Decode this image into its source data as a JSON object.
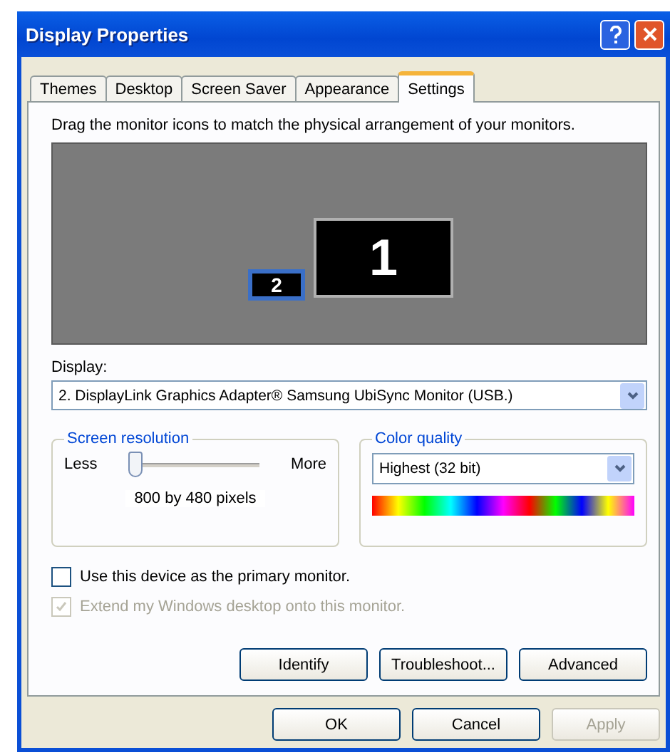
{
  "window": {
    "title": "Display Properties"
  },
  "tabs": [
    {
      "label": "Themes",
      "selected": false
    },
    {
      "label": "Desktop",
      "selected": false
    },
    {
      "label": "Screen Saver",
      "selected": false
    },
    {
      "label": "Appearance",
      "selected": false
    },
    {
      "label": "Settings",
      "selected": true
    }
  ],
  "description": "Drag the monitor icons to match the physical arrangement of your monitors.",
  "monitors": [
    {
      "label": "2",
      "selected": true
    },
    {
      "label": "1",
      "selected": false
    }
  ],
  "display": {
    "label": "Display:",
    "value": "2. DisplayLink Graphics Adapter® Samsung UbiSync Monitor (USB.)"
  },
  "resolution": {
    "title": "Screen resolution",
    "less": "Less",
    "more": "More",
    "level": 0,
    "reading": "800 by 480 pixels"
  },
  "color_quality": {
    "title": "Color quality",
    "value": "Highest (32 bit)"
  },
  "checkboxes": [
    {
      "label": "Use this device as the primary monitor.",
      "checked": false,
      "disabled": false
    },
    {
      "label": "Extend my Windows desktop onto this monitor.",
      "checked": true,
      "disabled": true
    }
  ],
  "buttons": [
    "Identify",
    "Troubleshoot...",
    "Advanced"
  ],
  "dialog_buttons": [
    {
      "label": "OK",
      "disabled": false
    },
    {
      "label": "Cancel",
      "disabled": false
    },
    {
      "label": "Apply",
      "disabled": true
    }
  ]
}
